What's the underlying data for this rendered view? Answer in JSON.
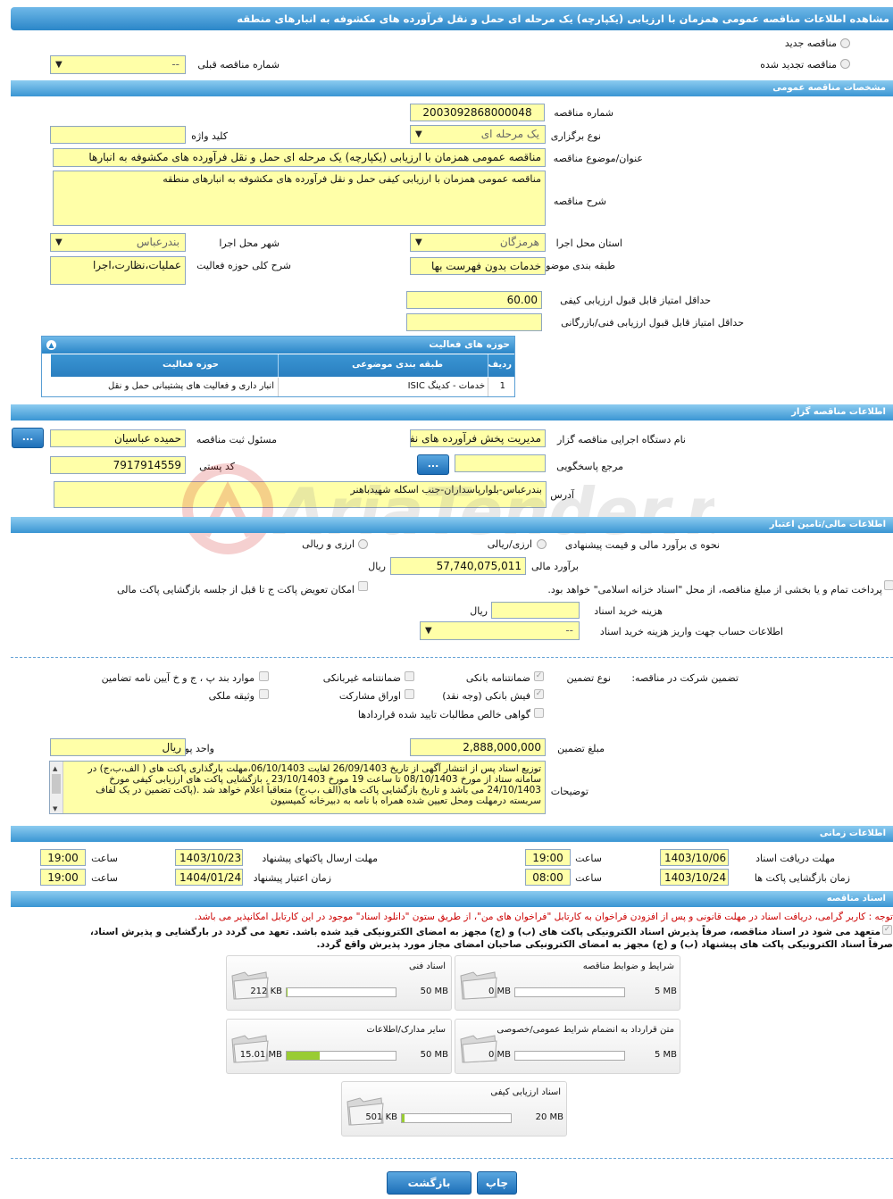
{
  "header": {
    "title": "مشاهده اطلاعات مناقصه عمومی همزمان با ارزیابی (یکپارچه) یک مرحله ای حمل و نقل فرآورده های مکشوفه به انبارهای منطقه"
  },
  "tender_type": {
    "new_label": "مناقصه جدید",
    "renewed_label": "مناقصه تجدید شده",
    "prev_no_label": "شماره مناقصه قبلی",
    "prev_no_value": "--"
  },
  "general": {
    "section_title": "مشخصات مناقصه عمومی",
    "number_label": "شماره مناقصه",
    "number_value": "2003092868000048",
    "holding_type_label": "نوع برگزاری",
    "holding_type_value": "یک مرحله ای",
    "keyword_label": "کلید واژه",
    "keyword_value": "",
    "subject_label": "عنوان/موضوع مناقصه",
    "subject_value": "مناقصه عمومی همزمان با ارزیابی (یکپارچه) یک مرحله ای حمل و نقل فرآورده های مکشوفه به انبارها",
    "description_label": "شرح مناقصه",
    "description_value": "مناقصه عمومی همزمان با ارزیابی کیفی حمل و نقل فرآورده های مکشوفه به انبارهای منطقه",
    "province_label": "استان محل اجرا",
    "province_value": "هرمزگان",
    "city_label": "شهر محل اجرا",
    "city_value": "بندرعباس",
    "category_label": "طبقه بندی موضوعی",
    "category_value": "خدمات بدون فهرست بها",
    "activity_label": "شرح کلی حوزه فعالیت",
    "activity_value": "عملیات،نظارت،اجرا",
    "min_quality_label": "حداقل امتیاز قابل قبول ارزیابی کیفی",
    "min_quality_value": "60.00",
    "min_tech_label": "حداقل امتیاز قابل قبول ارزیابی فنی/بازرگانی",
    "min_tech_value": ""
  },
  "activity_table": {
    "title": "حوزه های فعالیت",
    "headers": [
      "ردیف",
      "طبقه بندی موضوعی",
      "حوزه فعالیت"
    ],
    "rows": [
      [
        "1",
        "خدمات - کدینگ ISIC",
        "انبار داری و فعالیت های پشتیبانی حمل و نقل"
      ]
    ]
  },
  "organizer": {
    "section_title": "اطلاعات مناقصه گزار",
    "org_label": "نام دستگاه اجرایی مناقصه گزار",
    "org_value": "مدیریت پخش فرآورده های نفتی",
    "responsible_label": "مسئول ثبت مناقصه",
    "responsible_value": "حمیده عباسیان",
    "ref_label": "مرجع پاسخگویی",
    "ref_value": "",
    "postal_label": "کد پستی",
    "postal_value": "7917914559",
    "address_label": "آدرس",
    "address_value": "بندرعباس-بلوارپاسداران-جنب اسکله شهیدباهنر",
    "dots": "..."
  },
  "finance": {
    "section_title": "اطلاعات مالی/تامین اعتبار",
    "estimate_method_label": "نحوه ی برآورد مالی و قیمت پیشنهادی",
    "opt_rial": "ارزی/ریالی",
    "opt_currency": "ارزی و ریالی",
    "estimate_label": "برآورد مالی",
    "estimate_value": "57,740,075,011",
    "rial": "ریال",
    "treasury_text": "پرداخت تمام و یا بخشی از مبلغ مناقصه، از محل \"اسناد خزانه اسلامی\" خواهد بود.",
    "swap_text": "امکان تعویض پاکت ج تا قبل از جلسه بازگشایی پاکت مالی",
    "doc_fee_label": "هزینه خرید اسناد",
    "doc_fee_value": "",
    "account_label": "اطلاعات حساب جهت واریز هزینه خرید اسناد",
    "account_value": "--"
  },
  "guarantee": {
    "participation_label": "تضمین شرکت در مناقصه:",
    "type_label": "نوع تضمین",
    "items": [
      "ضمانتنامه بانکی",
      "ضمانتنامه غیربانکی",
      "موارد بند پ ، ج و خ آیین نامه تضامین",
      "فیش بانکی (وجه نقد)",
      "اوراق مشارکت",
      "وثیقه ملکی",
      "گواهی خالص مطالبات تایید شده قراردادها"
    ],
    "amount_label": "مبلغ تضمین",
    "amount_value": "2,888,000,000",
    "currency_label": "واحد پول",
    "currency_value": "ریال",
    "notes_label": "توضیحات",
    "notes_value": "توزیع اسناد پس از انتشار آگهی از تاریخ 26/09/1403 لغایت 06/10/1403،مهلت بارگذاری پاکت های ( الف،ب،ج) در سامانه ستاد از مورخ 08/10/1403 تا ساعت 19 مورخ 23/10/1403 ، بازگشایی پاکت های ارزیابی کیفی مورخ 24/10/1403 می باشد و تاریخ بازگشایی پاکت های(الف ،ب،ج) متعاقباً اعلام خواهد شد .(پاکت تضمین در یک لفاف سربسته درمهلت ومحل تعیین شده همراه با نامه به دبیرخانه کمیسیون"
  },
  "timing": {
    "section_title": "اطلاعات زمانی",
    "receive_label": "مهلت دریافت اسناد",
    "receive_date": "1403/10/06",
    "send_label": "مهلت ارسال پاکتهای پیشنهاد",
    "send_date": "1403/10/23",
    "send_time": "19:00",
    "open_label": "زمان بازگشایی پاکت ها",
    "open_date": "1403/10/24",
    "open_time": "08:00",
    "valid_label": "زمان اعتبار پیشنهاد",
    "valid_date": "1404/01/24",
    "valid_time": "19:00",
    "receive_time": "19:00",
    "time_label": "ساعت"
  },
  "docs": {
    "section_title": "اسناد مناقصه",
    "note_red": "توجه : کاربر گرامی، دریافت اسناد در مهلت قانونی و پس از افزودن فراخوان به کارتابل \"فراخوان های من\"، از طریق ستون \"دانلود اسناد\" موجود در این کارتابل امکانپذیر می باشد.",
    "note_bold1": "متعهد می شود در اسناد مناقصه، صرفاً پذیرش اسناد الکترونیکی پاکت های (ب) و (ج) مجهز به امضای الکترونیکی قید شده باشد. تعهد می گردد در بارگشایی و پذیرش اسناد،",
    "note_bold2": "صرفاً اسناد الکترونیکی پاکت های پیشنهاد (ب) و (ج) مجهز به امضای الکترونیکی صاحبان امضای مجاز مورد پذیرش واقع گردد.",
    "files": [
      {
        "name": "شرایط و ضوابط مناقصه",
        "size": "0 MB",
        "max": "5 MB",
        "fill": 0.0
      },
      {
        "name": "اسناد فنی",
        "size": "212 KB",
        "max": "50 MB",
        "fill": 0.01
      },
      {
        "name": "متن قرارداد به انضمام شرایط عمومی/خصوصی",
        "size": "0 MB",
        "max": "5 MB",
        "fill": 0.0
      },
      {
        "name": "سایر مدارک/اطلاعات",
        "size": "15.01 MB",
        "max": "50 MB",
        "fill": 0.3
      },
      {
        "name": "اسناد ارزیابی کیفی",
        "size": "501 KB",
        "max": "20 MB",
        "fill": 0.025
      }
    ]
  },
  "footer": {
    "print_label": "چاپ",
    "back_label": "بازگشت"
  },
  "watermark_text": "AriaTender.neT",
  "colors": {
    "accent": "#2a86c8",
    "field": "#ffffa8",
    "alert": "#cc0000"
  }
}
